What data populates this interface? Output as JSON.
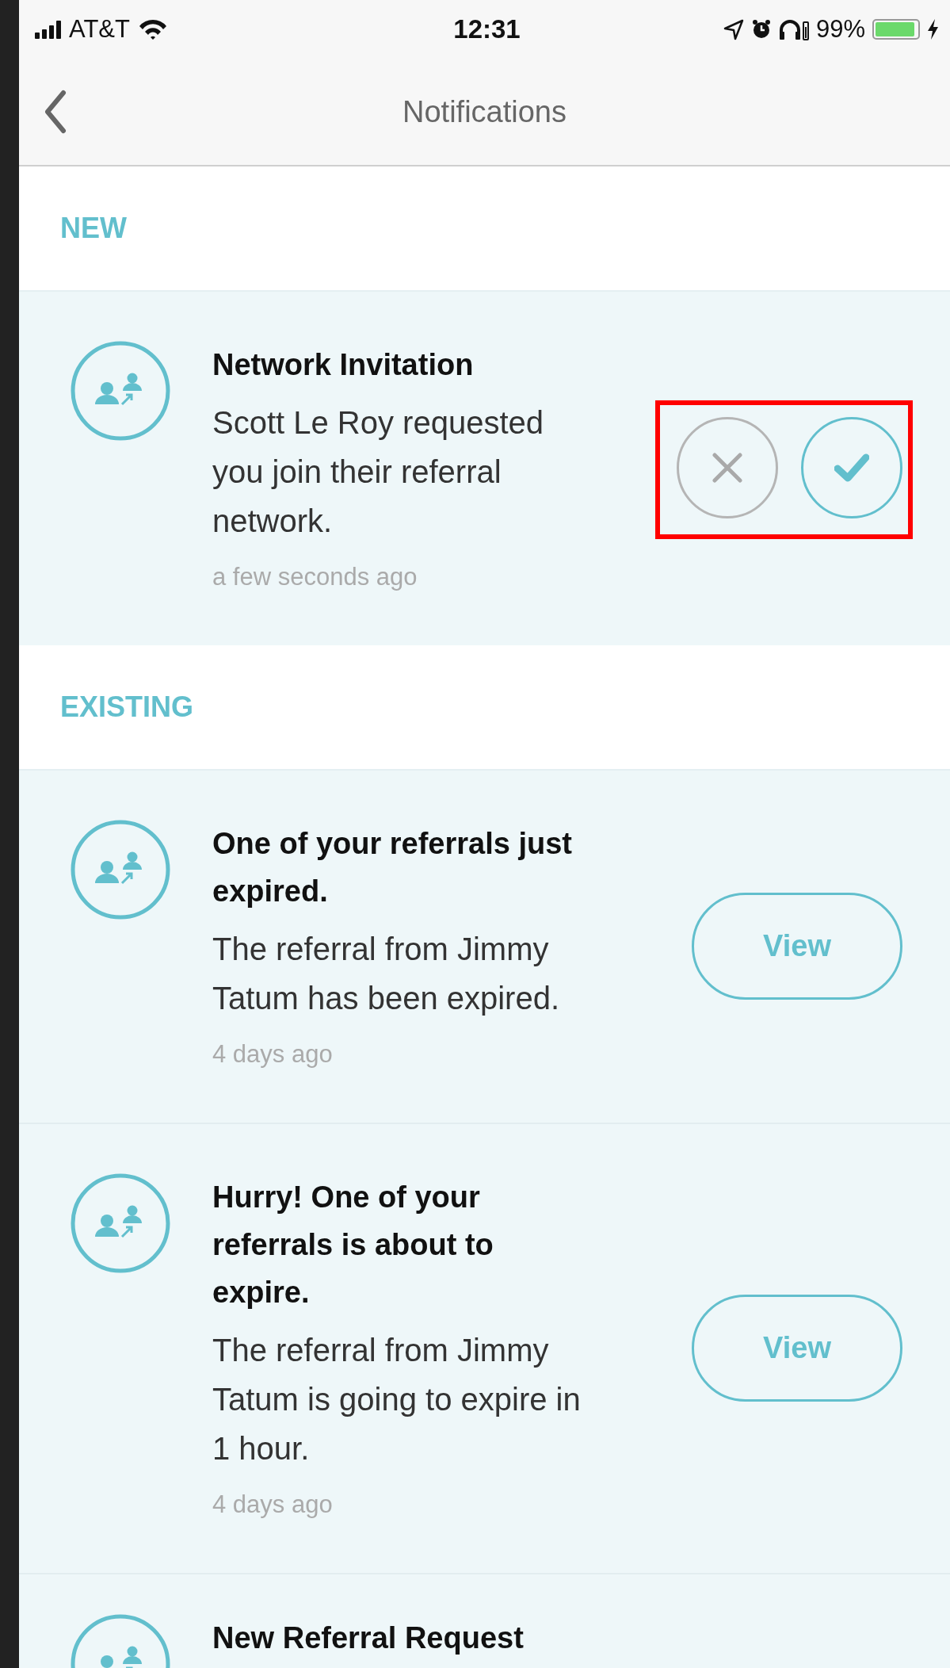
{
  "status_bar": {
    "carrier": "AT&T",
    "time": "12:31",
    "battery": "99%"
  },
  "nav": {
    "title": "Notifications"
  },
  "sections": [
    {
      "heading": "NEW",
      "notifications": [
        {
          "kind": "invitation",
          "title": "Network Invitation",
          "body": "Scott Le Roy requested you join their referral network.",
          "time": "a few seconds ago",
          "highlighted": true
        }
      ]
    },
    {
      "heading": "EXISTING",
      "notifications": [
        {
          "kind": "view",
          "title": "One of your referrals just expired.",
          "body": "The referral from Jimmy Tatum has been expired.",
          "time": "4 days ago",
          "button": "View"
        },
        {
          "kind": "view",
          "title": "Hurry! One of your referrals is about to expire.",
          "body": "The referral from Jimmy Tatum is going to expire in 1 hour.",
          "time": "4 days ago",
          "button": "View"
        },
        {
          "kind": "plain",
          "title": "New Referral Request"
        }
      ]
    }
  ]
}
